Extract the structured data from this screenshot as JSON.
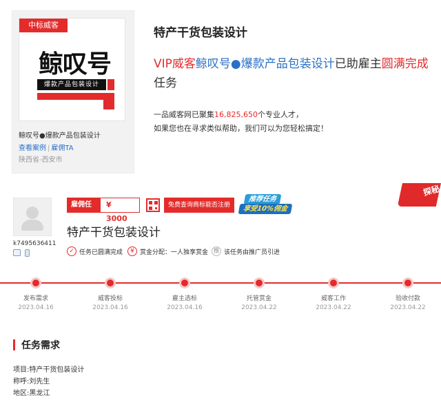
{
  "card": {
    "tag": "中标威客",
    "logo_text": "鲸叹号",
    "logo_subtitle": "爆款产品包装设计",
    "title": "鲸叹号●爆款产品包装设计",
    "link_cases": "查看案例",
    "link_hire": "雇佣TA",
    "location": "陕西省-西安市"
  },
  "top": {
    "title": "特产干货包装设计",
    "headline": {
      "p1": "VIP威客",
      "p2": "鲸叹号●爆款产品包装设计",
      "p3": "已助雇主",
      "p4": "圆满完成",
      "p5": "任务"
    },
    "stats": {
      "pre": "一品威客网已聚集",
      "num": "16,825,650",
      "post": "个专业人才，",
      "line2": "如果您也在寻求类似帮助，我们可以为您轻松搞定！"
    }
  },
  "ribbon": "探秘",
  "task": {
    "username": "k7495636411",
    "hire_label": "雇佣任务",
    "price": "¥ 3000",
    "check_btn": "免费查询商标能否注册",
    "promo_a": "推荐任务",
    "promo_b": "享受10%佣金",
    "title": "特产干货包装设计",
    "features": [
      {
        "icon": "✓",
        "text": "任务已圆满完成"
      },
      {
        "icon": "¥",
        "text": "赏金分配：一人独享赏金"
      },
      {
        "icon": "推",
        "text": "该任务由推广员引进"
      }
    ]
  },
  "steps": [
    {
      "name": "发布需求",
      "date": "2023.04.16"
    },
    {
      "name": "威客投标",
      "date": "2023.04.16"
    },
    {
      "name": "雇主选标",
      "date": "2023.04.16"
    },
    {
      "name": "托管赏金",
      "date": "2023.04.22"
    },
    {
      "name": "威客工作",
      "date": "2023.04.22"
    },
    {
      "name": "验收付款",
      "date": "2023.04.22"
    }
  ],
  "requirement": {
    "title": "任务需求",
    "lines": [
      "项目:特产干货包装设计",
      "称呼:刘先生",
      "地区:黑龙江"
    ]
  },
  "colors": {
    "accent": "#e32b2b",
    "link": "#2a70c8"
  }
}
